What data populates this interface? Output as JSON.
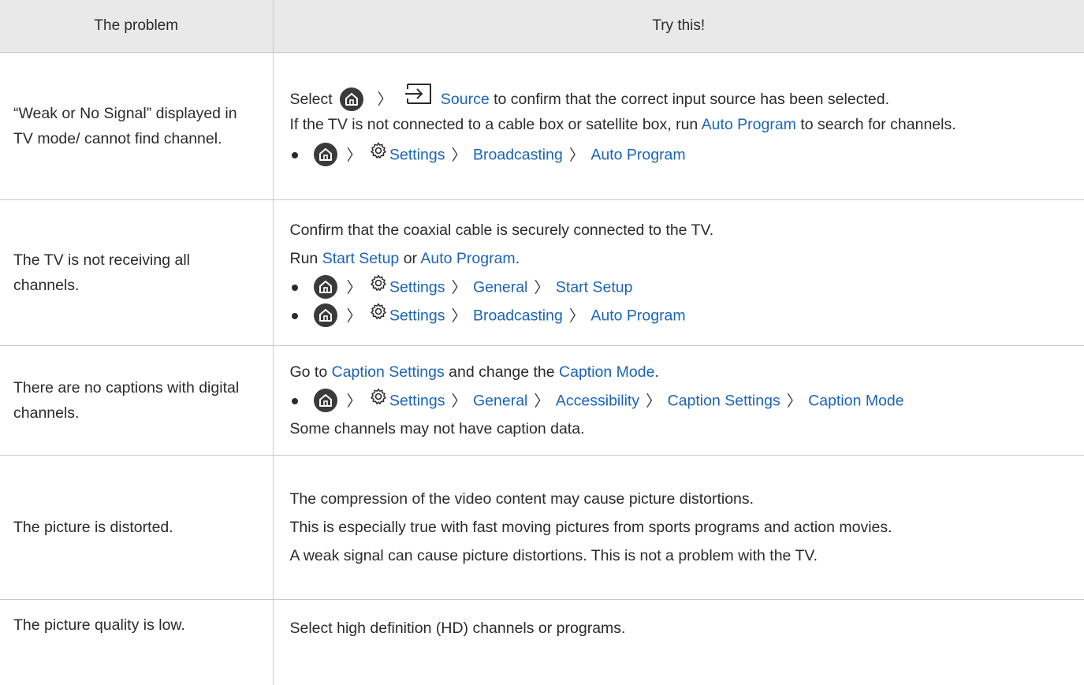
{
  "header": {
    "col_problem": "The problem",
    "col_try": "Try this!"
  },
  "common": {
    "settings": "Settings",
    "broadcasting": "Broadcasting",
    "auto_program": "Auto Program",
    "general": "General",
    "start_setup": "Start Setup",
    "accessibility": "Accessibility",
    "caption_settings": "Caption Settings",
    "caption_mode": "Caption Mode",
    "chevron": "〉"
  },
  "rows": {
    "r1": {
      "problem": "“Weak or No Signal” displayed in TV mode/ cannot find channel.",
      "select": "Select",
      "source": "Source",
      "source_rest": "to confirm that the correct input source has been selected.",
      "line2_a": "If the TV is not connected to a cable box or satellite box, run",
      "line2_b": "Auto Program",
      "line2_c": "to search for channels."
    },
    "r2": {
      "problem": "The TV is not receiving all channels.",
      "line1": "Confirm that the coaxial cable is securely connected to the TV.",
      "run": "Run",
      "start_setup": "Start Setup",
      "or": "or",
      "auto_program": "Auto Program",
      "period": "."
    },
    "r3": {
      "problem": "There are no captions with digital channels.",
      "goto": "Go to",
      "caption_settings": "Caption Settings",
      "and_change": "and change the",
      "caption_mode": "Caption Mode",
      "period": ".",
      "line3": "Some channels may not have caption data."
    },
    "r4": {
      "problem": "The picture is distorted.",
      "line1": "The compression of the video content may cause picture distortions.",
      "line2": "This is especially true with fast moving pictures from sports programs and action movies.",
      "line3": "A weak signal can cause picture distortions. This is not a problem with the TV."
    },
    "r5": {
      "problem": "The picture quality is low.",
      "line1": "Select high definition (HD) channels or programs."
    }
  },
  "icons": {
    "home": "home-icon",
    "settings": "gear-icon",
    "source": "source-input-icon",
    "bullet": "bullet-icon",
    "chevron": "chevron-right-icon"
  },
  "colors": {
    "link": "#1b64b9",
    "header_bg": "#e9e9e9",
    "border": "#c9c9c9"
  }
}
